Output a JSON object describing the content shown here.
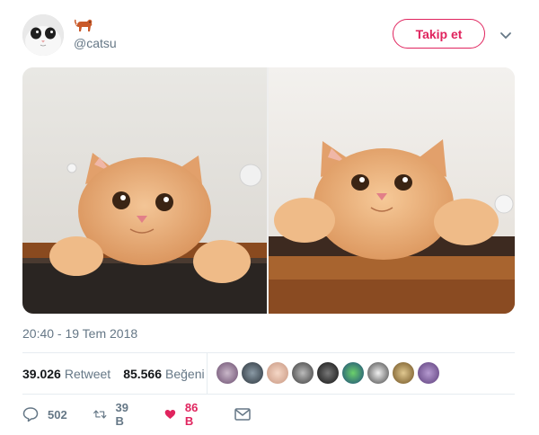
{
  "author": {
    "handle": "@catsu",
    "avatar_icon": "cat-face-avatar",
    "emoji_icon": "dog-emoji-icon"
  },
  "header": {
    "follow_label": "Takip et",
    "caret_icon": "chevron-down-icon"
  },
  "tweet": {
    "timestamp": "20:40 - 19 Tem 2018",
    "stats": {
      "retweet_count": "39.026",
      "retweet_label": "Retweet",
      "like_count": "85.566",
      "like_label": "Beğeni"
    },
    "liker_count_visible": 9
  },
  "actions": {
    "reply_count": "502",
    "retweet_count": "39 B",
    "like_count": "86 B"
  },
  "colors": {
    "accent": "#e0245e",
    "muted": "#657786",
    "divider": "#e6ecf0"
  }
}
